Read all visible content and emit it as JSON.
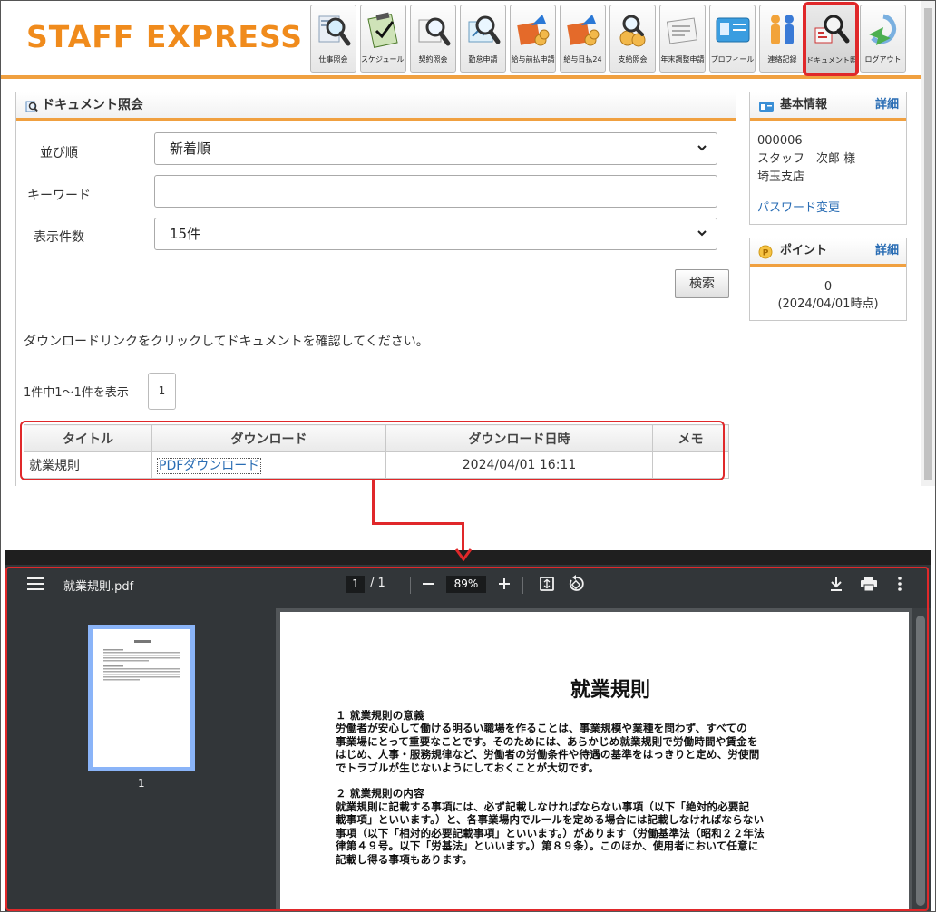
{
  "site": {
    "logo": "STAFF EXPRESS",
    "nav": [
      {
        "label": "仕事照会",
        "icon": "magnifier-document-icon"
      },
      {
        "label": "スケジュール申請",
        "icon": "clipboard-schedule-icon"
      },
      {
        "label": "契約照会",
        "icon": "magnifier-contract-icon"
      },
      {
        "label": "勤怠申請",
        "icon": "magnifier-timesheet-icon"
      },
      {
        "label": "給与前払申請",
        "icon": "advance-payment-icon"
      },
      {
        "label": "給与日払24",
        "icon": "daily-payment-icon"
      },
      {
        "label": "支給照会",
        "icon": "coins-magnifier-icon"
      },
      {
        "label": "年末調整申請",
        "icon": "year-end-form-icon"
      },
      {
        "label": "プロフィール",
        "icon": "id-card-icon"
      },
      {
        "label": "連絡記録",
        "icon": "people-icon"
      },
      {
        "label": "ドキュメント照会",
        "icon": "document-search-icon"
      },
      {
        "label": "ログアウト",
        "icon": "logout-arrow-icon"
      }
    ],
    "doc_panel": {
      "title": "ドキュメント照会",
      "sort_label": "並び順",
      "sort_value": "新着順",
      "keyword_label": "キーワード",
      "keyword_value": "",
      "per_page_label": "表示件数",
      "per_page_value": "15件",
      "search_button": "検索",
      "instruction": "ダウンロードリンクをクリックしてドキュメントを確認してください。",
      "result_count": "1件中1～1件を表示",
      "page_number": "1",
      "table": {
        "headers": [
          "タイトル",
          "ダウンロード",
          "ダウンロード日時",
          "メモ"
        ],
        "rows": [
          {
            "title": "就業規則",
            "download": "PDFダウンロード",
            "datetime": "2024/04/01 16:11",
            "memo": ""
          }
        ]
      }
    },
    "basic_info": {
      "title": "基本情報",
      "more": "詳細",
      "id": "000006",
      "name": "スタッフ　次郎 様",
      "branch": "埼玉支店",
      "password_link": "パスワード変更"
    },
    "points": {
      "title": "ポイント",
      "more": "詳細",
      "value": "0",
      "as_of": "(2024/04/01時点)"
    }
  },
  "viewer": {
    "filename": "就業規則.pdf",
    "current_page": "1",
    "total_pages": "/ 1",
    "zoom": "89%",
    "thumb_label": "1",
    "page": {
      "title": "就業規則",
      "section1_title": "１ 就業規則の意義",
      "section1_lines": [
        "労働者が安心して働ける明るい職場を作ることは、事業規模や業種を問わず、すべての",
        "事業場にとって重要なことです。そのためには、あらかじめ就業規則で労働時間や賃金を",
        "はじめ、人事・服務規律など、労働者の労働条件や待遇の基準をはっきりと定め、労使間",
        "でトラブルが生じないようにしておくことが大切です。"
      ],
      "section2_title": "２ 就業規則の内容",
      "section2_lines": [
        "就業規則に記載する事項には、必ず記載しなければならない事項（以下「絶対的必要記",
        "載事項」といいます。）と、各事業場内でルールを定める場合には記載しなければならない",
        "事項（以下「相対的必要記載事項」といいます。）があります（労働基準法（昭和２２年法",
        "律第４９号。以下「労基法」といいます。）第８９条）。このほか、使用者において任意に",
        "記載し得る事項もあります。"
      ]
    }
  },
  "colors": {
    "brand_orange": "#f08b1c",
    "accent_orange": "#f0a040",
    "highlight_red": "#e0282a",
    "link_blue": "#2a6db4",
    "viewer_toolbar": "#323639"
  }
}
